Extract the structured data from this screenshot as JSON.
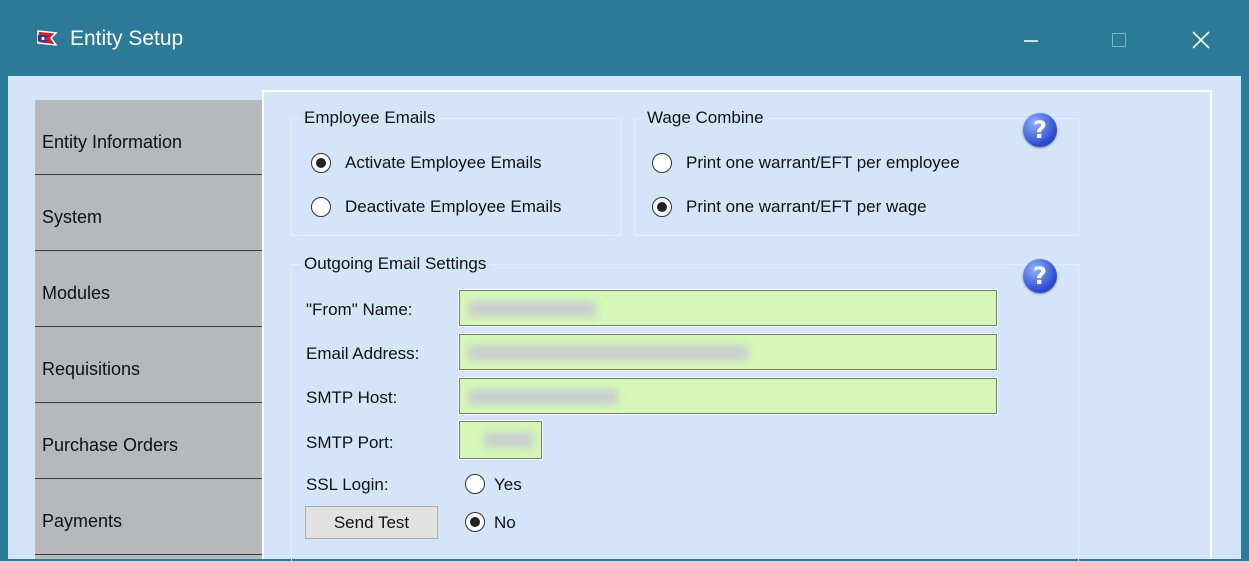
{
  "window": {
    "title": "Entity Setup",
    "icon": "flag-app-icon",
    "controls": [
      "minimize-icon",
      "maximize-icon",
      "close-icon"
    ]
  },
  "nav": {
    "items": [
      {
        "label": "Entity Information"
      },
      {
        "label": "System"
      },
      {
        "label": "Modules"
      },
      {
        "label": "Requisitions"
      },
      {
        "label": "Purchase Orders"
      },
      {
        "label": "Payments"
      }
    ]
  },
  "employee_emails": {
    "legend": "Employee Emails",
    "options": [
      {
        "label": "Activate Employee Emails",
        "checked": true
      },
      {
        "label": "Deactivate Employee Emails",
        "checked": false
      }
    ]
  },
  "wage_combine": {
    "legend": "Wage Combine",
    "options": [
      {
        "label": "Print one warrant/EFT per employee",
        "checked": false
      },
      {
        "label": "Print one warrant/EFT per wage",
        "checked": true
      }
    ]
  },
  "outgoing_email": {
    "legend": "Outgoing Email Settings",
    "from_name_label": "\"From\" Name:",
    "email_address_label": "Email Address:",
    "smtp_host_label": "SMTP Host:",
    "smtp_port_label": "SMTP Port:",
    "ssl_login_label": "SSL Login:",
    "ssl_yes_label": "Yes",
    "ssl_no_label": "No",
    "ssl_selected": "No",
    "send_test_label": "Send Test"
  },
  "colors": {
    "titlebar": "#2b7a98",
    "client_bg": "#d4e5f9",
    "nav_bg": "#b6b8bc",
    "field_bg": "#d5f8b6"
  }
}
